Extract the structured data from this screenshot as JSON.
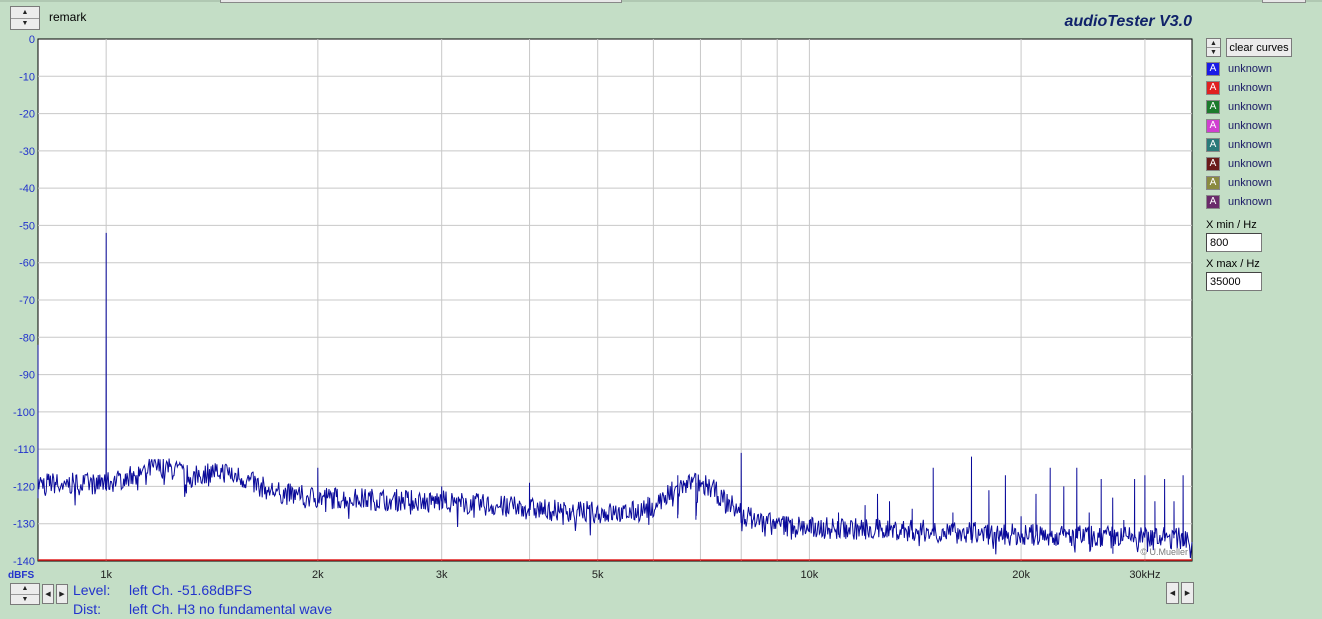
{
  "header": {
    "remark": "remark",
    "brand": "audioTester  V3.0"
  },
  "legend": {
    "clear_label": "clear curves",
    "items": [
      {
        "label": "unknown",
        "color": "#1a1ae6",
        "glyph": "A"
      },
      {
        "label": "unknown",
        "color": "#e02020",
        "glyph": "A"
      },
      {
        "label": "unknown",
        "color": "#1c7a2c",
        "glyph": "A"
      },
      {
        "label": "unknown",
        "color": "#d040d0",
        "glyph": "A"
      },
      {
        "label": "unknown",
        "color": "#2a7a7a",
        "glyph": "A"
      },
      {
        "label": "unknown",
        "color": "#6a1a1a",
        "glyph": "A"
      },
      {
        "label": "unknown",
        "color": "#8a8a40",
        "glyph": "A"
      },
      {
        "label": "unknown",
        "color": "#6a2a6a",
        "glyph": "A"
      }
    ]
  },
  "controls": {
    "xmin_label": "X min / Hz",
    "xmin_value": "800",
    "xmax_label": "X max / Hz",
    "xmax_value": "35000"
  },
  "info": {
    "level_label": "Level:",
    "level_value": "left Ch. -51.68dBFS",
    "dist_label": "Dist:",
    "dist_value": "left Ch. H3 no fundamental wave"
  },
  "chart_data": {
    "type": "line",
    "xscale": "log",
    "xlim": [
      800,
      35000
    ],
    "ylim": [
      -140,
      0
    ],
    "ylabel": "dBFS",
    "grid": true,
    "yticks": [
      0,
      -10,
      -20,
      -30,
      -40,
      -50,
      -60,
      -70,
      -80,
      -90,
      -100,
      -110,
      -120,
      -130,
      -140
    ],
    "ytick_labels": [
      "0",
      "-10",
      "-20",
      "-30",
      "-40",
      "-50",
      "-60",
      "-70",
      "-80",
      "-90",
      "-100",
      "-110",
      "-120",
      "-130",
      "-140"
    ],
    "xgrid": [
      1000,
      2000,
      3000,
      4000,
      5000,
      6000,
      7000,
      8000,
      9000,
      10000,
      20000,
      30000
    ],
    "xticks": [
      1000,
      2000,
      3000,
      5000,
      10000,
      20000,
      30000
    ],
    "xtick_labels": [
      "1k",
      "2k",
      "3k",
      "5k",
      "10k",
      "20k",
      "30kHz"
    ],
    "watermark": "© U.Mueller",
    "series": [
      {
        "color": "#0a0a9a",
        "noise_floor": [
          [
            800,
            -119
          ],
          [
            1500,
            -121
          ],
          [
            2000,
            -123
          ],
          [
            3000,
            -124
          ],
          [
            4000,
            -126
          ],
          [
            5000,
            -127
          ],
          [
            7000,
            -129
          ],
          [
            10000,
            -131
          ],
          [
            15000,
            -132
          ],
          [
            20000,
            -133
          ],
          [
            35000,
            -134
          ]
        ],
        "peaks": [
          [
            800,
            -82
          ],
          [
            1000,
            -52
          ],
          [
            1000,
            -72
          ],
          [
            2000,
            -115
          ],
          [
            3000,
            -120
          ],
          [
            4000,
            -119
          ],
          [
            6500,
            -117
          ],
          [
            6900,
            -119
          ],
          [
            8000,
            -111
          ],
          [
            10000,
            -129
          ],
          [
            11000,
            -127
          ],
          [
            12000,
            -125
          ],
          [
            12500,
            -122
          ],
          [
            13000,
            -124
          ],
          [
            14000,
            -126
          ],
          [
            15000,
            -115
          ],
          [
            16000,
            -127
          ],
          [
            17000,
            -112
          ],
          [
            18000,
            -121
          ],
          [
            19000,
            -117
          ],
          [
            20000,
            -128
          ],
          [
            21000,
            -122
          ],
          [
            22000,
            -115
          ],
          [
            23000,
            -120
          ],
          [
            24000,
            -115
          ],
          [
            25000,
            -127
          ],
          [
            26000,
            -118
          ],
          [
            27000,
            -123
          ],
          [
            28000,
            -129
          ],
          [
            29000,
            -118
          ],
          [
            30000,
            -117
          ],
          [
            31000,
            -124
          ],
          [
            32000,
            -118
          ],
          [
            33000,
            -124
          ],
          [
            34000,
            -117
          ]
        ],
        "bumps": [
          [
            1200,
            -115
          ],
          [
            1450,
            -116
          ],
          [
            6900,
            -119
          ]
        ]
      },
      {
        "color": "#e02020",
        "values": [
          [
            800,
            -140
          ],
          [
            35000,
            -140
          ]
        ]
      }
    ]
  }
}
